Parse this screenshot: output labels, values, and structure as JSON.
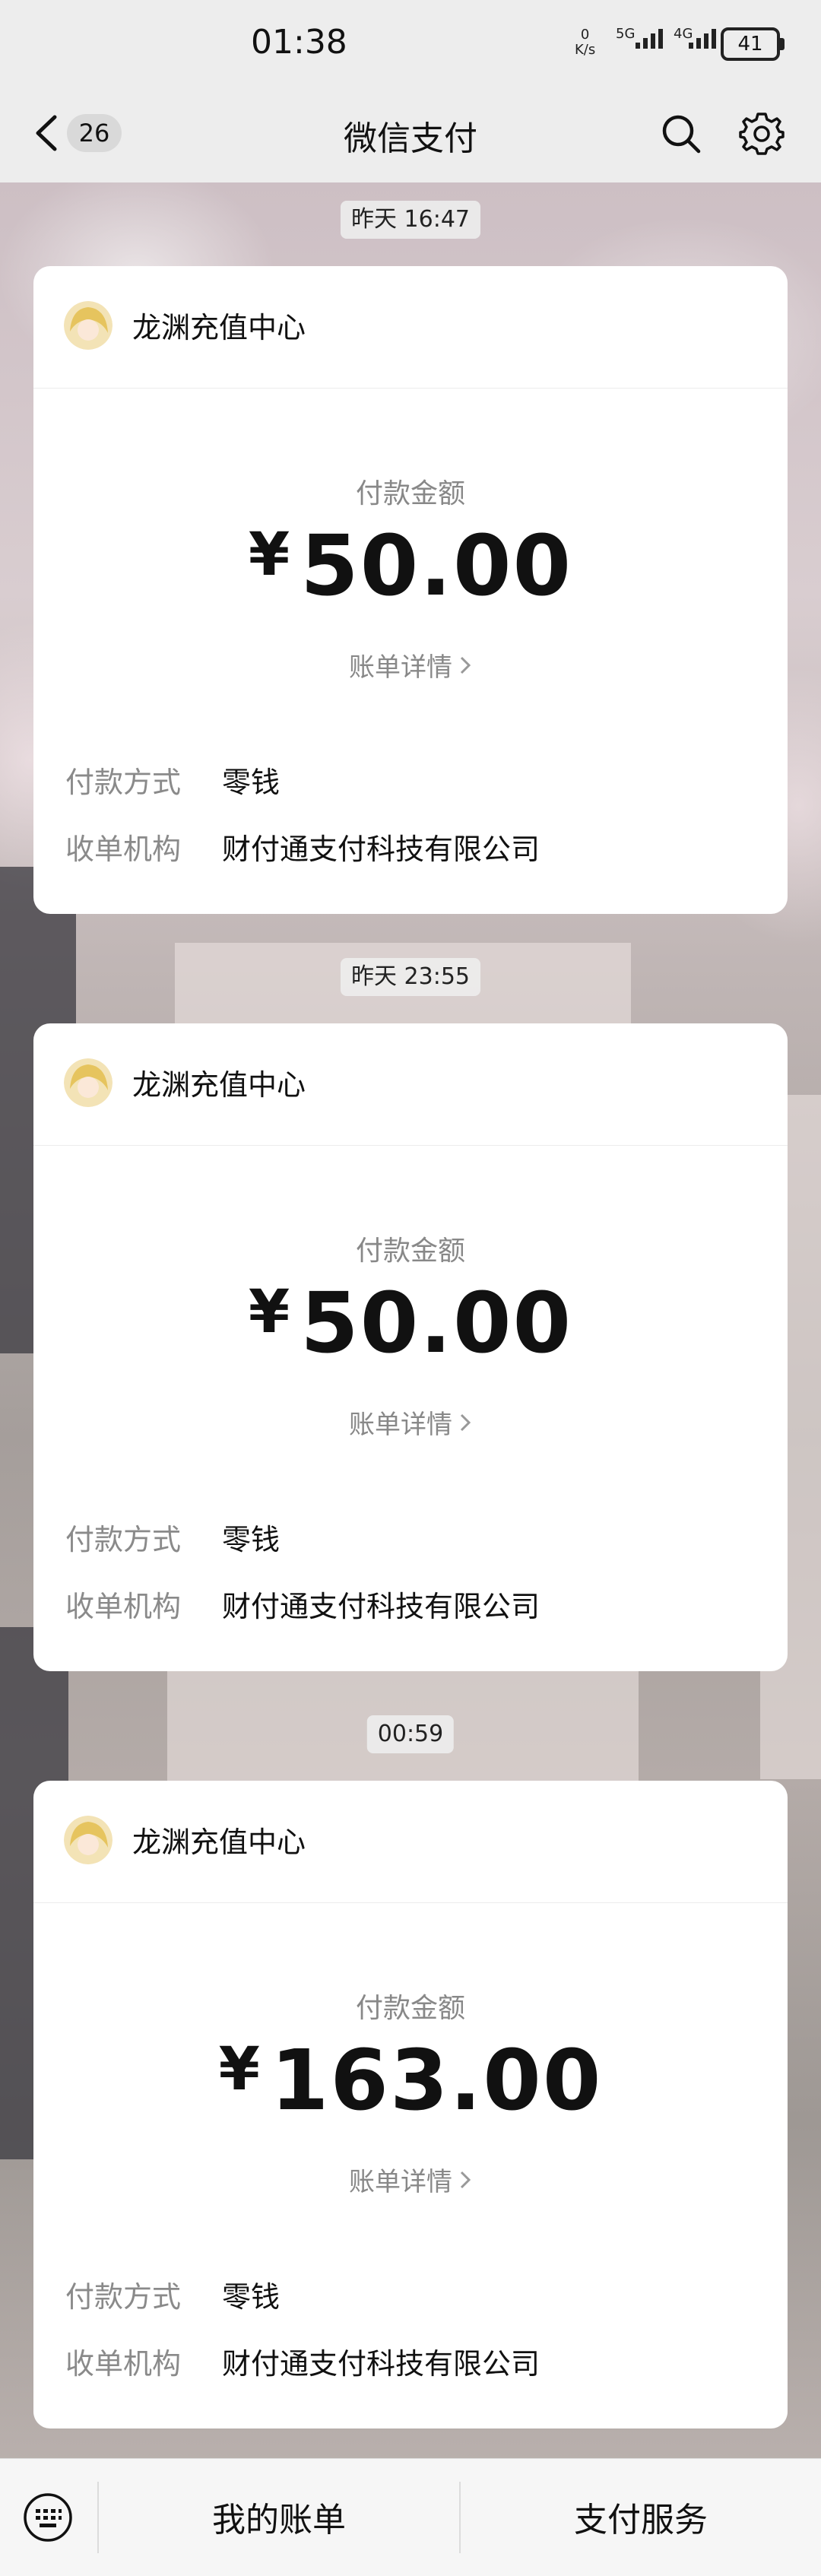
{
  "status_bar": {
    "time": "01:38",
    "net_speed_value": "0",
    "net_speed_unit": "K/s",
    "signal_1": "5G",
    "signal_2": "4G",
    "battery": "41"
  },
  "nav": {
    "unread_count": "26",
    "title": "微信支付"
  },
  "messages": [
    {
      "timestamp": "昨天 16:47",
      "merchant": "龙渊充值中心",
      "amount_label": "付款金额",
      "currency": "¥",
      "amount": "50.00",
      "detail_link": "账单详情",
      "method_label": "付款方式",
      "method_value": "零钱",
      "acquirer_label": "收单机构",
      "acquirer_value": "财付通支付科技有限公司"
    },
    {
      "timestamp": "昨天 23:55",
      "merchant": "龙渊充值中心",
      "amount_label": "付款金额",
      "currency": "¥",
      "amount": "50.00",
      "detail_link": "账单详情",
      "method_label": "付款方式",
      "method_value": "零钱",
      "acquirer_label": "收单机构",
      "acquirer_value": "财付通支付科技有限公司"
    },
    {
      "timestamp": "00:59",
      "merchant": "龙渊充值中心",
      "amount_label": "付款金额",
      "currency": "¥",
      "amount": "163.00",
      "detail_link": "账单详情",
      "method_label": "付款方式",
      "method_value": "零钱",
      "acquirer_label": "收单机构",
      "acquirer_value": "财付通支付科技有限公司"
    }
  ],
  "bottom_bar": {
    "tab_bills": "我的账单",
    "tab_services": "支付服务"
  },
  "colors": {
    "nav_background": "#ededed",
    "card_background": "#ffffff",
    "muted_text": "#888888",
    "primary_text": "#111111"
  }
}
